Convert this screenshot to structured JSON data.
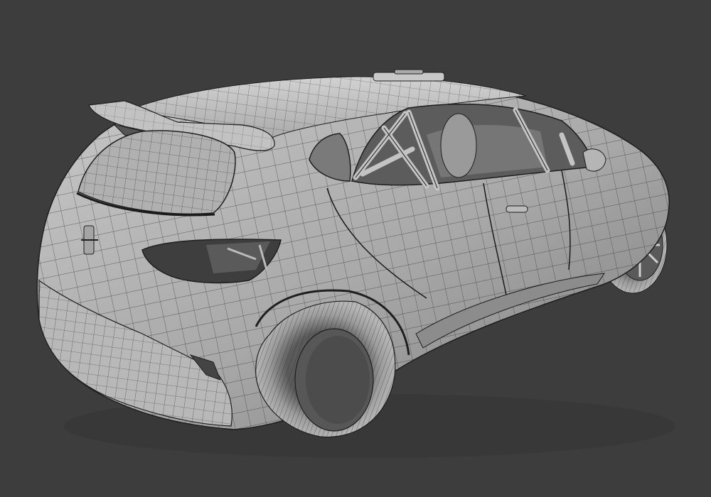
{
  "viewport": {
    "background": "#3d3d3d",
    "subject": "car-wireframe-model"
  },
  "colors": {
    "body_light": "#bdbdbd",
    "body_mid": "#9a9a9a",
    "body_dark": "#5e5e5e",
    "wire": "#1e1e1e",
    "glass": "#6b6b6b",
    "tire": "#a9a9a9",
    "cabin_dark": "#4a4a4a"
  }
}
